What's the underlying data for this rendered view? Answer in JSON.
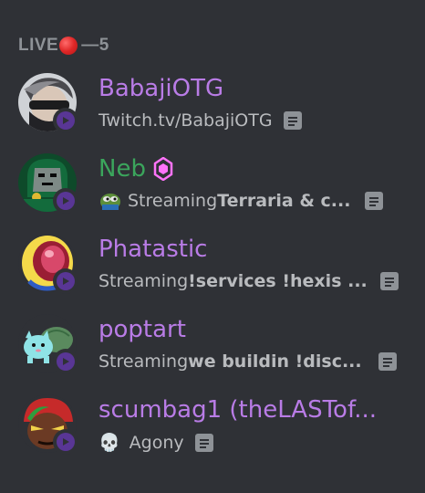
{
  "header": {
    "live_label": "LIVE",
    "count": "—5"
  },
  "members": [
    {
      "name": "BabajiOTG",
      "name_color": "#b97ce6",
      "activity_plain": "Twitch.tv/BabajiOTG",
      "activity_prefix": "",
      "activity_bold": ""
    },
    {
      "name": "Neb",
      "name_color": "#3ba55c",
      "activity_prefix": "Streaming ",
      "activity_bold": "Terraria & c...",
      "badge": "nitro-booster-icon"
    },
    {
      "name": "Phatastic",
      "name_color": "#b97ce6",
      "activity_prefix": "Streaming ",
      "activity_bold": "!services !hexis ..."
    },
    {
      "name": "poptart",
      "name_color": "#b97ce6",
      "activity_prefix": "Streaming ",
      "activity_bold": "we buildin !disc..."
    },
    {
      "name": "scumbag1 (theLASTof...",
      "name_color": "#b97ce6",
      "activity_plain": "Agony",
      "activity_emoji": "💀"
    }
  ]
}
